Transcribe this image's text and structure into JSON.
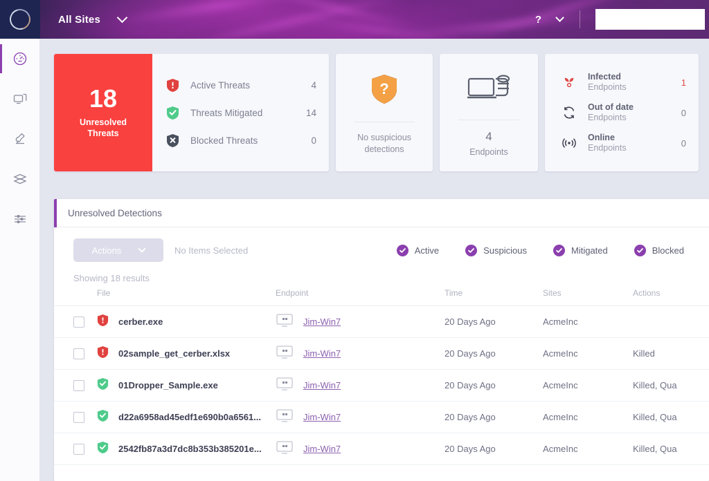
{
  "header": {
    "logo_name": "sentinel-logo",
    "site_selector_label": "All Sites",
    "help_label": "?"
  },
  "sidebar": {
    "items": [
      {
        "name": "dashboard",
        "icon": "gauge-icon",
        "active": true
      },
      {
        "name": "endpoints",
        "icon": "monitor-icon",
        "active": false
      },
      {
        "name": "forensics",
        "icon": "microscope-icon",
        "active": false
      },
      {
        "name": "network",
        "icon": "flow-icon",
        "active": false
      },
      {
        "name": "settings",
        "icon": "sliders-icon",
        "active": false
      }
    ]
  },
  "stats": {
    "threats": {
      "count": "18",
      "caption_line1": "Unresolved",
      "caption_line2": "Threats",
      "accent_color": "#f9413f",
      "rows": [
        {
          "icon": "shield-alert-icon",
          "label": "Active Threats",
          "value": "4"
        },
        {
          "icon": "shield-check-icon",
          "label": "Threats Mitigated",
          "value": "14"
        },
        {
          "icon": "shield-blocked-icon",
          "label": "Blocked Threats",
          "value": "0"
        }
      ]
    },
    "suspicious": {
      "icon": "shield-question-icon",
      "icon_color": "#f5a council",
      "text_line1": "No suspicious",
      "text_line2": "detections"
    },
    "endpoints": {
      "icon": "devices-icon",
      "count": "4",
      "label": "Endpoints"
    },
    "endpoint_status": {
      "rows": [
        {
          "icon": "radiation-icon",
          "title": "Infected",
          "subtitle": "Endpoints",
          "value": "1",
          "danger": true
        },
        {
          "icon": "refresh-icon",
          "title": "Out of date",
          "subtitle": "Endpoints",
          "value": "0",
          "danger": false
        },
        {
          "icon": "signal-icon",
          "title": "Online",
          "subtitle": "Endpoints",
          "value": "0",
          "danger": false
        }
      ]
    }
  },
  "panel": {
    "title": "Unresolved Detections",
    "accent_color": "#8b3fae",
    "toolbar": {
      "actions_label": "Actions",
      "selection_status": "No Items Selected",
      "showing_results": "Showing 18 results",
      "filters": [
        {
          "label": "Active",
          "checked": true
        },
        {
          "label": "Suspicious",
          "checked": true
        },
        {
          "label": "Mitigated",
          "checked": true
        },
        {
          "label": "Blocked",
          "checked": true
        }
      ]
    },
    "table": {
      "columns": [
        "",
        "File",
        "Endpoint",
        "Time",
        "Sites",
        "Actions"
      ],
      "rows": [
        {
          "status": "active",
          "file": "cerber.exe",
          "endpoint": "Jim-Win7",
          "time": "20 Days Ago",
          "site": "AcmeInc",
          "actions": ""
        },
        {
          "status": "active",
          "file": "02sample_get_cerber.xlsx",
          "endpoint": "Jim-Win7",
          "time": "20 Days Ago",
          "site": "AcmeInc",
          "actions": "Killed"
        },
        {
          "status": "mitigated",
          "file": "01Dropper_Sample.exe",
          "endpoint": "Jim-Win7",
          "time": "20 Days Ago",
          "site": "AcmeInc",
          "actions": "Killed, Qua"
        },
        {
          "status": "mitigated",
          "file": "d22a6958ad45edf1e690b0a6561...",
          "endpoint": "Jim-Win7",
          "time": "20 Days Ago",
          "site": "AcmeInc",
          "actions": "Killed, Qua"
        },
        {
          "status": "mitigated",
          "file": "2542fb87a3d7dc8b353b385201e...",
          "endpoint": "Jim-Win7",
          "time": "20 Days Ago",
          "site": "AcmeInc",
          "actions": "Killed, Qua"
        }
      ]
    }
  }
}
